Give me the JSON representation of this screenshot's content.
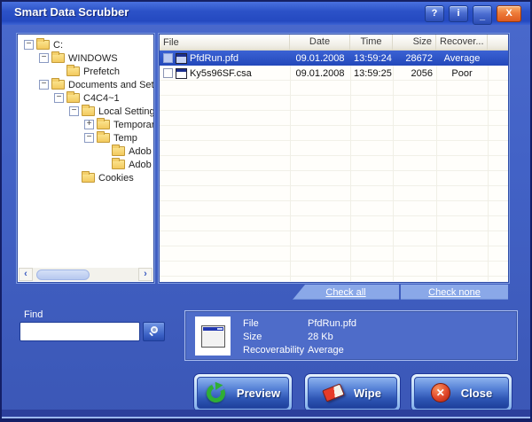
{
  "window": {
    "title": "Smart Data Scrubber",
    "controls": {
      "help": "?",
      "info": "i",
      "minimize": "_",
      "close": "X"
    }
  },
  "tree": {
    "items": [
      {
        "label": "C:",
        "level": 0,
        "expander": "minus"
      },
      {
        "label": "WINDOWS",
        "level": 1,
        "expander": "minus"
      },
      {
        "label": "Prefetch",
        "level": 2,
        "expander": "none"
      },
      {
        "label": "Documents and Settin",
        "level": 1,
        "expander": "minus"
      },
      {
        "label": "C4C4~1",
        "level": 2,
        "expander": "minus"
      },
      {
        "label": "Local Settings",
        "level": 3,
        "expander": "minus"
      },
      {
        "label": "Temporar",
        "level": 4,
        "expander": "plus"
      },
      {
        "label": "Temp",
        "level": 4,
        "expander": "minus"
      },
      {
        "label": "Adob",
        "level": 5,
        "expander": "none"
      },
      {
        "label": "Adob",
        "level": 5,
        "expander": "none"
      },
      {
        "label": "Cookies",
        "level": 3,
        "expander": "none"
      }
    ]
  },
  "filelist": {
    "columns": [
      "File",
      "Date",
      "Time",
      "Size",
      "Recover..."
    ],
    "rows": [
      {
        "file": "PfdRun.pfd",
        "date": "09.01.2008",
        "time": "13:59:24",
        "size": "28672",
        "recover": "Average",
        "selected": true
      },
      {
        "file": "Ky5s96SF.csa",
        "date": "09.01.2008",
        "time": "13:59:25",
        "size": "2056",
        "recover": "Poor",
        "selected": false
      }
    ],
    "check_all": "Check all",
    "check_none": "Check none"
  },
  "find": {
    "label": "Find",
    "value": "",
    "placeholder": ""
  },
  "details": {
    "file_label": "File",
    "file_value": "PfdRun.pfd",
    "size_label": "Size",
    "size_value": "28 Kb",
    "recover_label": "Recoverability",
    "recover_value": "Average"
  },
  "buttons": {
    "preview": "Preview",
    "wipe": "Wipe",
    "close": "Close"
  },
  "colors": {
    "title_bar": "#2c52c8",
    "client_background": "#4262c6",
    "selection": "#2e55c8",
    "check_bar": "#8aa8e8",
    "close_button": "#ee7c3a",
    "big_button_face": "#2e56b4",
    "preview_icon_green": "#2fae35",
    "close_icon_red": "#e0462a",
    "folder_yellow": "#f3c95e"
  }
}
